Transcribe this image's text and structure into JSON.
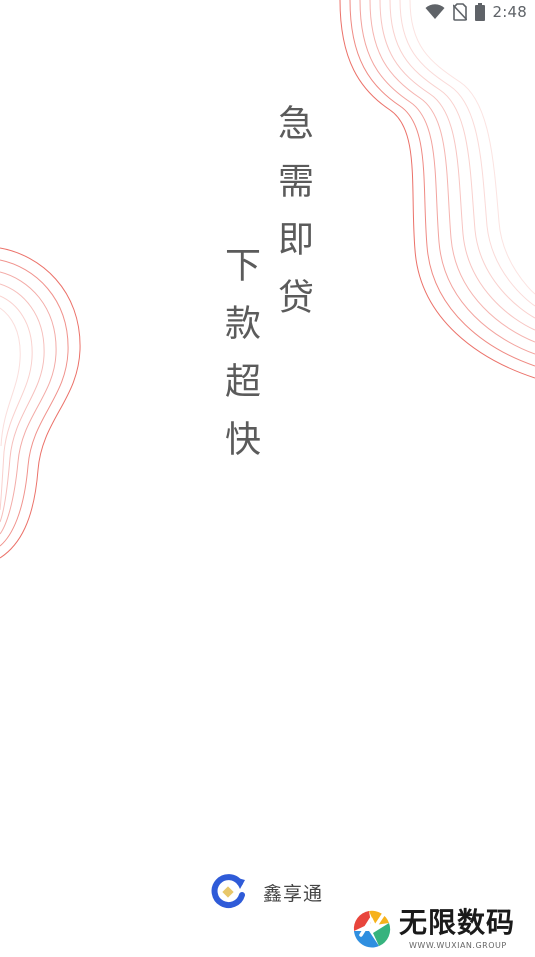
{
  "status_bar": {
    "time": "2:48",
    "icons": [
      "wifi-icon",
      "no-sim-icon",
      "battery-icon"
    ]
  },
  "slogans": {
    "line1": "急需即贷",
    "line2": "下款超快"
  },
  "brand": {
    "name": "鑫享通",
    "logo_icon": "refresh-coin-icon",
    "logo_color": "#2f5bd8"
  },
  "watermark": {
    "text": "无限数码",
    "subtext": "WWW.WUXIAN.GROUP"
  },
  "colors": {
    "wave": "#e8584f",
    "slogan": "#5b5b5b",
    "status": "#5f6368"
  }
}
